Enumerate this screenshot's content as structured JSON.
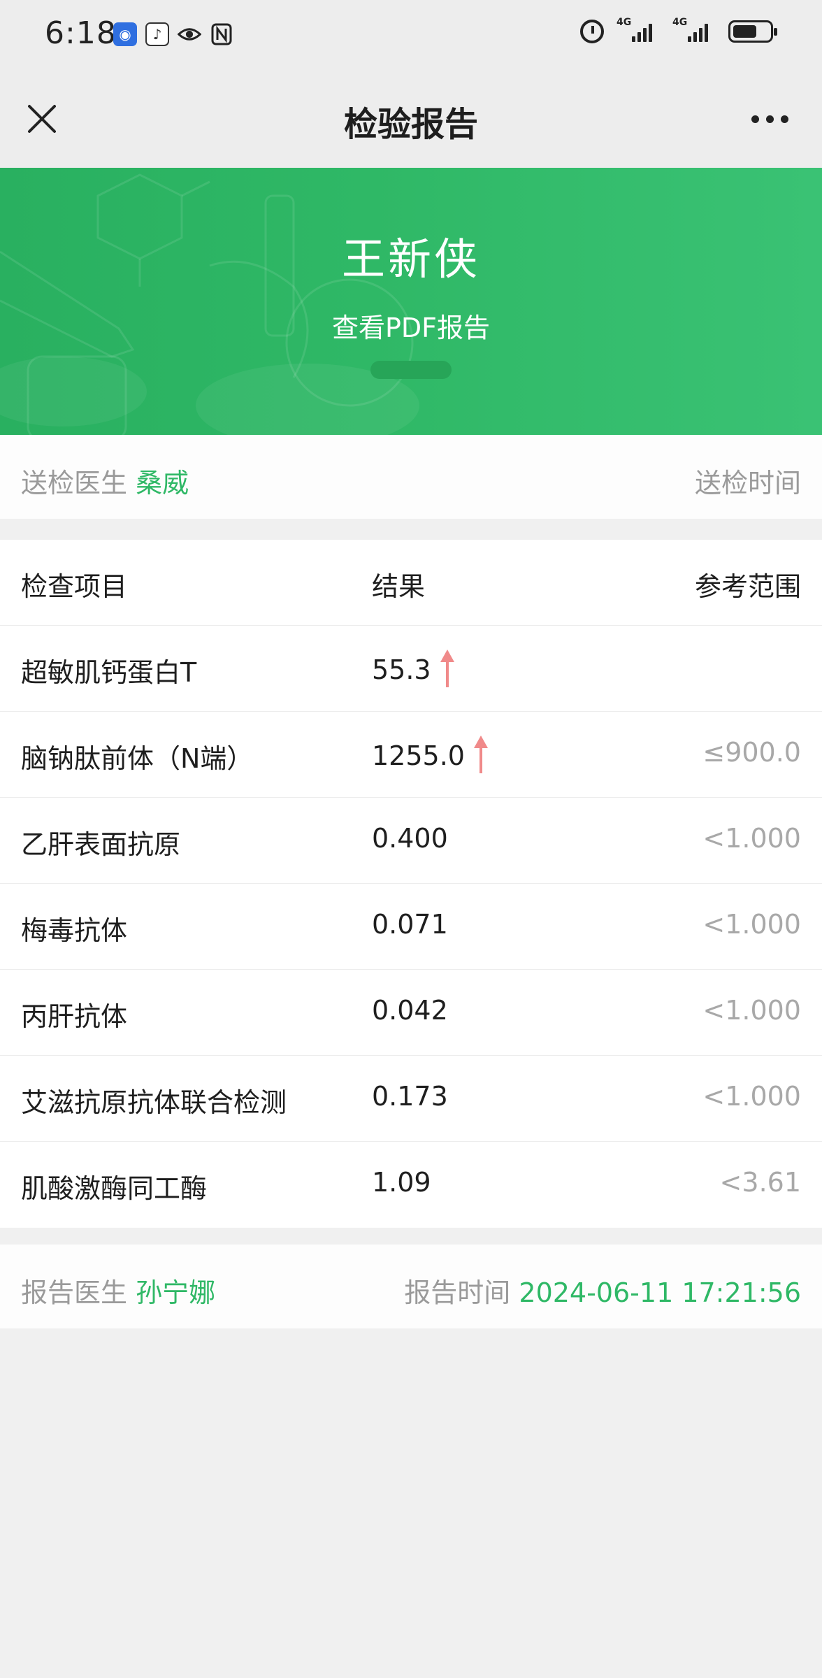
{
  "status_bar": {
    "time": "6:18",
    "network_label_1": "4G",
    "network_label_2": "4G",
    "battery_level": 0.65,
    "icons": [
      "app-icon-blue",
      "app-icon-white",
      "eye-icon",
      "nfc-icon",
      "alarm-icon",
      "signal-icon",
      "signal-icon",
      "battery-icon"
    ]
  },
  "header": {
    "title": "检验报告",
    "close_icon": "close-icon",
    "more_icon": "more-icon"
  },
  "banner": {
    "patient_name": "王新侠",
    "pdf_link": "查看PDF报告"
  },
  "request_info": {
    "doctor_label": "送检医生",
    "doctor_name": "桑威",
    "time_label": "送检时间"
  },
  "table": {
    "headers": {
      "item": "检查项目",
      "result": "结果",
      "range": "参考范围"
    },
    "rows": [
      {
        "item": "超敏肌钙蛋白T",
        "result": "55.3",
        "flag": "up",
        "range": ""
      },
      {
        "item": "脑钠肽前体（N端）",
        "result": "1255.0",
        "flag": "up",
        "range": "≤900.0"
      },
      {
        "item": "乙肝表面抗原",
        "result": "0.400",
        "flag": "",
        "range": "<1.000"
      },
      {
        "item": "梅毒抗体",
        "result": "0.071",
        "flag": "",
        "range": "<1.000"
      },
      {
        "item": "丙肝抗体",
        "result": "0.042",
        "flag": "",
        "range": "<1.000"
      },
      {
        "item": "艾滋抗原抗体联合检测",
        "result": "0.173",
        "flag": "",
        "range": "<1.000"
      },
      {
        "item": "肌酸激酶同工酶",
        "result": "1.09",
        "flag": "",
        "range": "<3.61"
      }
    ]
  },
  "report_info": {
    "doctor_label": "报告医生",
    "doctor_name": "孙宁娜",
    "time_label": "报告时间",
    "time_value": "2024-06-11 17:21:56"
  },
  "colors": {
    "accent": "#2fb866",
    "arrow_up": "#f08a8a",
    "muted": "#9a9a9a"
  }
}
